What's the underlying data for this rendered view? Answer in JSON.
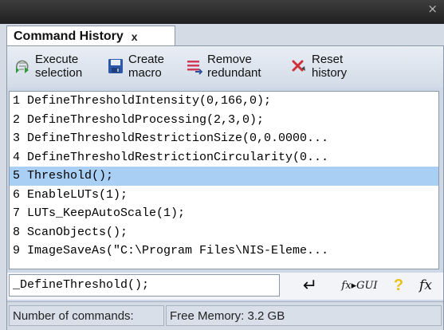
{
  "window": {
    "close_glyph": "×"
  },
  "tab": {
    "label": "Command History",
    "close_glyph": "x"
  },
  "toolbar": {
    "execute": {
      "line1": "Execute",
      "line2": "selection",
      "icon": "execute-icon"
    },
    "create_macro": {
      "line1": "Create",
      "line2": "macro",
      "icon": "save-disk-icon"
    },
    "remove": {
      "line1": "Remove",
      "line2": "redundant",
      "icon": "list-remove-icon"
    },
    "reset": {
      "line1": "Reset",
      "line2": "history",
      "icon": "reset-x-icon"
    }
  },
  "history": {
    "selected_index": 4,
    "rows": [
      "1 DefineThresholdIntensity(0,166,0);",
      "2 DefineThresholdProcessing(2,3,0);",
      "3 DefineThresholdRestrictionSize(0,0.0000...",
      "4 DefineThresholdRestrictionCircularity(0...",
      "5 Threshold();",
      "6 EnableLUTs(1);",
      "7 LUTs_KeepAutoScale(1);",
      "8 ScanObjects();",
      "9 ImageSaveAs(\"C:\\Program Files\\NIS-Eleme..."
    ]
  },
  "command": {
    "value": "_DefineThreshold();",
    "enter_glyph": "↵",
    "fx_gui_label": "fx▸GUI",
    "help_glyph": "?",
    "fx_label": "fx"
  },
  "status": {
    "commands": "Number of commands:",
    "memory": "Free Memory: 3.2 GB"
  },
  "colors": {
    "selection": "#a9cff4",
    "panel": "#cdd7e5",
    "titlebar": "#2a2a2a"
  }
}
